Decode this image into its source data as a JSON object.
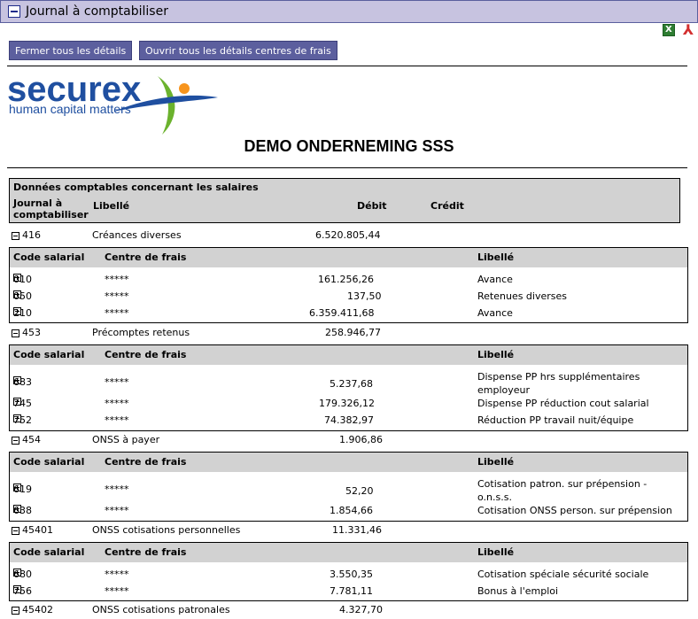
{
  "window": {
    "title": "Journal à comptabiliser"
  },
  "toolbar": {
    "close_details": "Fermer tous les détails",
    "open_details": "Ouvrir tous les détails centres de frais"
  },
  "export": {
    "excel_icon": "excel-icon",
    "pdf_icon": "pdf-icon"
  },
  "logo": {
    "brand": "securex",
    "tagline": "human capital matters",
    "colors": {
      "blue": "#1f4fa0",
      "orange": "#f7941d",
      "green": "#6bb22d"
    }
  },
  "company": "DEMO ONDERNEMING SSS",
  "header": {
    "caption": "Données comptables concernant les salaires",
    "col_journal": "Journal à comptabiliser",
    "col_libelle": "Libellé",
    "col_debit": "Débit",
    "col_credit": "Crédit"
  },
  "detail_header": {
    "code": "Code salarial",
    "centre": "Centre de frais",
    "libelle": "Libellé"
  },
  "sections": [
    {
      "account": "416",
      "label": "Créances diverses",
      "debit": "6.520.805,44",
      "rows": [
        {
          "code": "010",
          "centre": "*****",
          "amount": "161.256,26",
          "libelle": "Avance"
        },
        {
          "code": "050",
          "centre": "*****",
          "amount": "137,50",
          "libelle": "Retenues diverses"
        },
        {
          "code": "210",
          "centre": "*****",
          "amount": "6.359.411,68",
          "libelle": "Avance"
        }
      ]
    },
    {
      "account": "453",
      "label": "Précomptes retenus",
      "debit": "258.946,77",
      "rows": [
        {
          "code": "683",
          "centre": "*****",
          "amount": "5.237,68",
          "libelle": "Dispense PP hrs supplémentaires",
          "libelle2": "employeur"
        },
        {
          "code": "745",
          "centre": "*****",
          "amount": "179.326,12",
          "libelle": "Dispense PP réduction cout salarial"
        },
        {
          "code": "752",
          "centre": "*****",
          "amount": "74.382,97",
          "libelle": "Réduction PP travail nuit/équipe"
        }
      ]
    },
    {
      "account": "454",
      "label": "ONSS à payer",
      "debit": "1.906,86",
      "rows": [
        {
          "code": "619",
          "centre": "*****",
          "amount": "52,20",
          "libelle": "Cotisation patron. sur prépension -",
          "libelle2": "o.n.s.s."
        },
        {
          "code": "638",
          "centre": "*****",
          "amount": "1.854,66",
          "libelle": "Cotisation ONSS person. sur prépension"
        }
      ]
    },
    {
      "account": "45401",
      "label": "ONSS cotisations personnelles",
      "debit": "11.331,46",
      "rows": [
        {
          "code": "680",
          "centre": "*****",
          "amount": "3.550,35",
          "libelle": "Cotisation spéciale sécurité sociale"
        },
        {
          "code": "756",
          "centre": "*****",
          "amount": "7.781,11",
          "libelle": "Bonus à l'emploi"
        }
      ]
    },
    {
      "account": "45402",
      "label": "ONSS cotisations patronales",
      "debit": "4.327,70",
      "rows": []
    }
  ]
}
